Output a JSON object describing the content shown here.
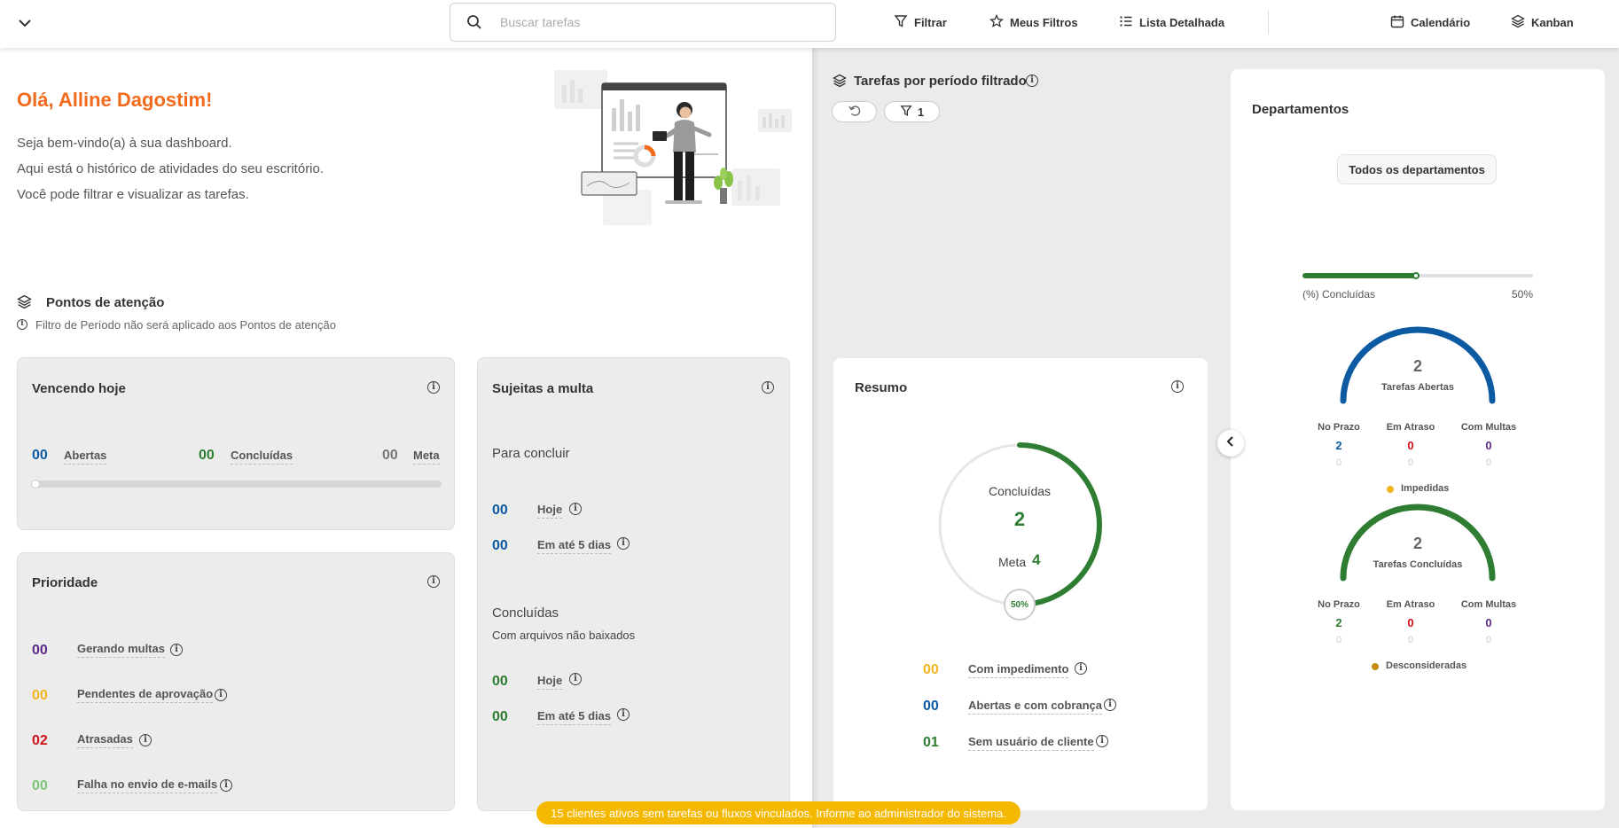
{
  "topbar": {
    "search_placeholder": "Buscar tarefas",
    "filter_label": "Filtrar",
    "my_filters_label": "Meus Filtros",
    "detailed_list_label": "Lista Detalhada",
    "calendar_label": "Calendário",
    "kanban_label": "Kanban"
  },
  "welcome": {
    "greeting": "Olá, Alline Dagostim!",
    "line1": "Seja bem-vindo(a) à sua dashboard.",
    "line2": "Aqui está o histórico de atividades do seu escritório.",
    "line3": "Você pode filtrar e visualizar as tarefas."
  },
  "attention": {
    "title": "Pontos de atenção",
    "note": "Filtro de Período não será aplicado aos Pontos de atenção"
  },
  "due_today": {
    "title": "Vencendo hoje",
    "open_value": "00",
    "open_label": "Abertas",
    "done_value": "00",
    "done_label": "Concluídas",
    "goal_value": "00",
    "goal_label": "Meta",
    "progress": 0
  },
  "fine": {
    "title": "Sujeitas a multa",
    "to_finish_label": "Para concluir",
    "today_value": "00",
    "today_label": "Hoje",
    "five_days_value": "00",
    "five_days_label": "Em até 5 dias",
    "completed_label": "Concluídas",
    "completed_sub": "Com arquivos não baixados",
    "c_today_value": "00",
    "c_today_label": "Hoje",
    "c_five_days_value": "00",
    "c_five_days_label": "Em até 5 dias"
  },
  "priority": {
    "title": "Prioridade",
    "items": [
      {
        "value": "00",
        "label": "Gerando multas",
        "color": "#5b2a86"
      },
      {
        "value": "00",
        "label": "Pendentes de aprovação",
        "color": "#f2b51d"
      },
      {
        "value": "02",
        "label": "Atrasadas",
        "color": "#d0101c"
      },
      {
        "value": "00",
        "label": "Falha no envio de e-mails",
        "color": "#7cc679"
      }
    ]
  },
  "period": {
    "title": "Tarefas por período filtrado",
    "filter_count": "1"
  },
  "summary": {
    "title": "Resumo",
    "completed_label": "Concluídas",
    "completed_value": "2",
    "goal_label": "Meta",
    "goal_value": "4",
    "percent_label": "50%",
    "percent": 0.5,
    "items": [
      {
        "value": "00",
        "label": "Com impedimento",
        "color": "#f2b51d"
      },
      {
        "value": "00",
        "label": "Abertas e com cobrança",
        "color": "#0b5aa2"
      },
      {
        "value": "01",
        "label": "Sem usuário de cliente",
        "color": "#2e7d32"
      }
    ]
  },
  "departments": {
    "title": "Departamentos",
    "all_button": "Todos os departamentos",
    "completed_pct_label": "(%) Concluídas",
    "completed_pct_value": "50%",
    "completed_pct": 0.5,
    "open": {
      "count": "2",
      "label": "Tarefas Abertas",
      "color": "#0b5aa2",
      "on_time_label": "No Prazo",
      "on_time": "2",
      "on_time_sub": "0",
      "late_label": "Em Atraso",
      "late": "0",
      "late_sub": "0",
      "fines_label": "Com Multas",
      "fines": "0",
      "fines_sub": "0",
      "legend": "Impedidas",
      "legend_color": "#f2b51d"
    },
    "closed": {
      "count": "2",
      "label": "Tarefas Concluídas",
      "color": "#2e7d32",
      "on_time_label": "No Prazo",
      "on_time": "2",
      "on_time_sub": "0",
      "late_label": "Em Atraso",
      "late": "0",
      "late_sub": "0",
      "fines_label": "Com Multas",
      "fines": "0",
      "fines_sub": "0",
      "legend": "Desconsideradas",
      "legend_color": "#c48a12"
    }
  },
  "banner": {
    "text": "15 clientes ativos sem tarefas ou fluxos vinculados. Informe ao administrador do sistema."
  },
  "colors": {
    "accent": "#f26a1b",
    "blue": "#0b5aa2",
    "green": "#2e7d32",
    "red": "#d0101c",
    "purple": "#5b2a86",
    "yellow": "#f2b51d"
  }
}
